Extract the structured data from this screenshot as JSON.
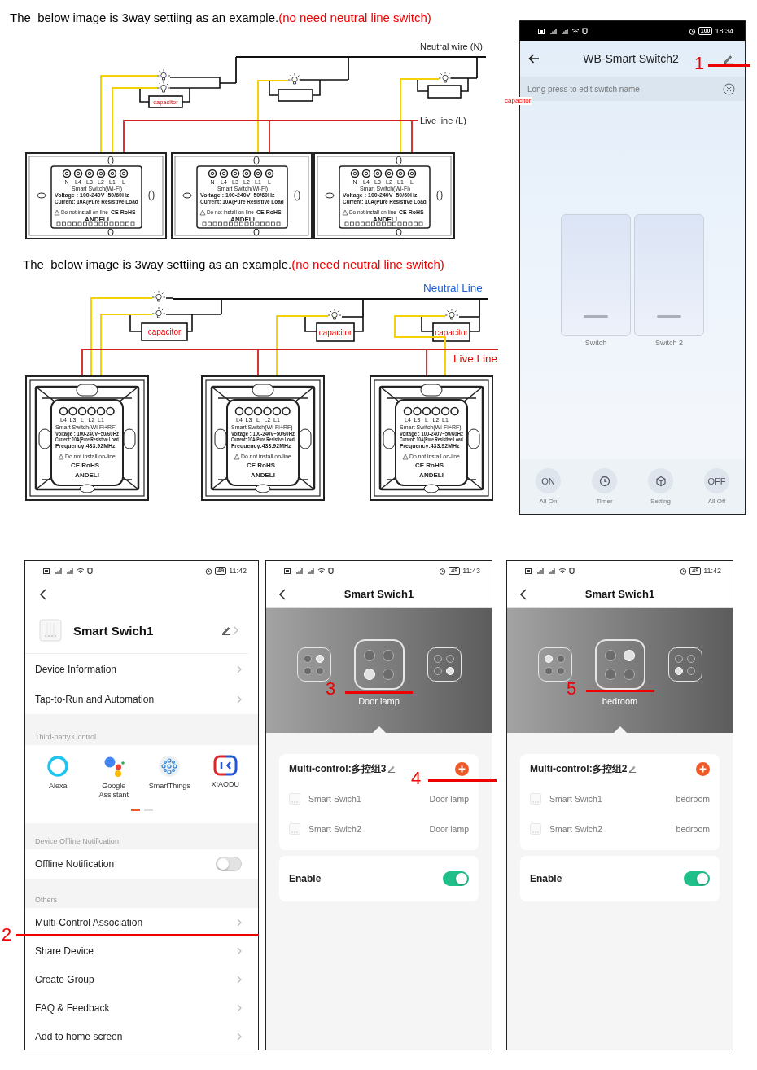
{
  "diagrams": [
    {
      "kind": "wifi",
      "heading": "The  below image is 3way settiing as an example.",
      "note": "(no need neutral line switch)",
      "neutral_label": "Neutral wire (N)",
      "live_label": "Live line (L)",
      "capacitor_labels": [
        "capacitor"
      ],
      "switches": [
        {
          "terminals": [
            "N",
            "L4",
            "L3",
            "L2",
            "L1",
            "L"
          ],
          "model": "Smart Switch(Wi-Fi)",
          "specs": [
            "Voltage : 100-240V~50/60Hz",
            "Current: 10A(Pure Resistive Load"
          ],
          "warning": "Do not install on-line",
          "certification": "CE RoHS",
          "brand": "ANDELI"
        },
        {
          "terminals": [
            "N",
            "L4",
            "L3",
            "L2",
            "L1",
            "L"
          ],
          "model": "Smart Switch(Wi-Fi)",
          "specs": [
            "Voltage : 100-240V~50/60Hz",
            "Current: 10A(Pure Resistive Load"
          ],
          "warning": "Do not install on-line",
          "certification": "CE RoHS",
          "brand": "ANDELI"
        },
        {
          "terminals": [
            "N",
            "L4",
            "L3",
            "L2",
            "L1",
            "L"
          ],
          "model": "Smart Switch(Wi-Fi)",
          "specs": [
            "Voltage : 100-240V~50/60Hz",
            "Current: 10A(Pure Resistive Load"
          ],
          "warning": "Do not install on-line",
          "certification": "CE RoHS",
          "brand": "ANDELI"
        }
      ]
    },
    {
      "kind": "wifi_rf",
      "heading": "The  below image is 3way settiing as an example.",
      "note": "(no need neutral line switch)",
      "neutral_label": "Neutral Line",
      "live_label": "Live Line",
      "capacitor_labels": [
        "capacitor",
        "capacitor",
        "capacitor"
      ],
      "switches": [
        {
          "terminals": [
            "L4",
            "L3",
            "L",
            "L2",
            "L1"
          ],
          "model": "Smart Switch(Wi-Fi+RF)",
          "specs": [
            "Voltage : 100-240V~50/60Hz",
            "Current: 10A(Pure Resistive Load",
            "Frequency:433.92MHz"
          ],
          "warning": "Do not install on-line",
          "certification": "CE RoHS",
          "brand": "ANDELI"
        },
        {
          "terminals": [
            "L4",
            "L3",
            "L",
            "L2",
            "L1"
          ],
          "model": "Smart Switch(Wi-Fi+RF)",
          "specs": [
            "Voltage : 100-240V~50/60Hz",
            "Current: 10A(Pure Resistive Load",
            "Frequency:433.92MHz"
          ],
          "warning": "Do not install on-line",
          "certification": "CE RoHS",
          "brand": "ANDELI"
        },
        {
          "terminals": [
            "L4",
            "L3",
            "L",
            "L2",
            "L1"
          ],
          "model": "Smart Switch(Wi-Fi+RF)",
          "specs": [
            "Voltage : 100-240V~50/60Hz",
            "Current: 10A(Pure Resistive Load",
            "Frequency:433.92MHz"
          ],
          "warning": "Do not install on-line",
          "certification": "CE RoHS",
          "brand": "ANDELI"
        }
      ]
    }
  ],
  "stray_label": "capacitor",
  "screens": [
    {
      "kind": "switch_panel",
      "status": {
        "time": "18:34",
        "battery": "100"
      },
      "title": "WB-Smart Switch2",
      "banner": "Long press to edit switch name",
      "switches": [
        {
          "label": "Switch"
        },
        {
          "label": "Switch 2"
        }
      ],
      "actions": [
        {
          "kind": "text",
          "glyph": "ON",
          "label": "All On"
        },
        {
          "kind": "timer",
          "label": "Timer"
        },
        {
          "kind": "setting",
          "label": "Setting"
        },
        {
          "kind": "text",
          "glyph": "OFF",
          "label": "All Off"
        }
      ]
    },
    {
      "kind": "device_settings",
      "status": {
        "time": "11:42",
        "battery": "49"
      },
      "device_name": "Smart Swich1",
      "items": [
        "Device Information",
        "Tap-to-Run and Automation"
      ],
      "third_party": {
        "title": "Third-party Control",
        "services": [
          {
            "kind": "alexa",
            "label": "Alexa"
          },
          {
            "kind": "google",
            "label": "Google Assistant"
          },
          {
            "kind": "smartthings",
            "label": "SmartThings"
          },
          {
            "kind": "xiaodu",
            "label": "XIAODU"
          }
        ],
        "pages": [
          {
            "selected": true
          },
          {
            "selected": false
          }
        ]
      },
      "offline": {
        "title": "Device Offline Notification",
        "label": "Offline Notification",
        "on": false
      },
      "others": {
        "title": "Others",
        "items": [
          "Multi-Control Association",
          "Share Device",
          "Create Group",
          "FAQ & Feedback",
          "Add to home screen"
        ]
      }
    },
    {
      "kind": "multi_control",
      "status": {
        "time": "11:43",
        "battery": "49"
      },
      "title": "Smart Swich1",
      "gangs": [
        {
          "selected": false,
          "dots": [
            {
              "on": false
            },
            {
              "on": true
            },
            {
              "on": false
            },
            {
              "on": false
            }
          ]
        },
        {
          "selected": true,
          "dots": [
            {
              "on": false
            },
            {
              "on": false
            },
            {
              "on": true
            },
            {
              "on": false
            }
          ]
        },
        {
          "selected": false,
          "dots": [
            {
              "on": false
            },
            {
              "on": false
            },
            {
              "on": false
            },
            {
              "on": true
            }
          ]
        }
      ],
      "gang_label": "Door lamp",
      "group": {
        "title": "Multi-control:多控组3",
        "members": [
          {
            "device": "Smart Swich1",
            "switch": "Door lamp"
          },
          {
            "device": "Smart Swich2",
            "switch": "Door lamp"
          }
        ]
      },
      "enable": {
        "label": "Enable",
        "on": true
      }
    },
    {
      "kind": "multi_control",
      "status": {
        "time": "11:42",
        "battery": "49"
      },
      "title": "Smart Swich1",
      "gangs": [
        {
          "selected": false,
          "dots": [
            {
              "on": true
            },
            {
              "on": false
            },
            {
              "on": false
            },
            {
              "on": false
            }
          ]
        },
        {
          "selected": true,
          "dots": [
            {
              "on": false
            },
            {
              "on": true
            },
            {
              "on": false
            },
            {
              "on": false
            }
          ]
        },
        {
          "selected": false,
          "dots": [
            {
              "on": false
            },
            {
              "on": false
            },
            {
              "on": true
            },
            {
              "on": false
            }
          ]
        }
      ],
      "gang_label": "bedroom",
      "group": {
        "title": "Multi-control:多控组2",
        "members": [
          {
            "device": "Smart Swich1",
            "switch": "bedroom"
          },
          {
            "device": "Smart Swich2",
            "switch": "bedroom"
          }
        ]
      },
      "enable": {
        "label": "Enable",
        "on": true
      }
    }
  ],
  "annotations": [
    "1",
    "2",
    "3",
    "4",
    "5"
  ]
}
